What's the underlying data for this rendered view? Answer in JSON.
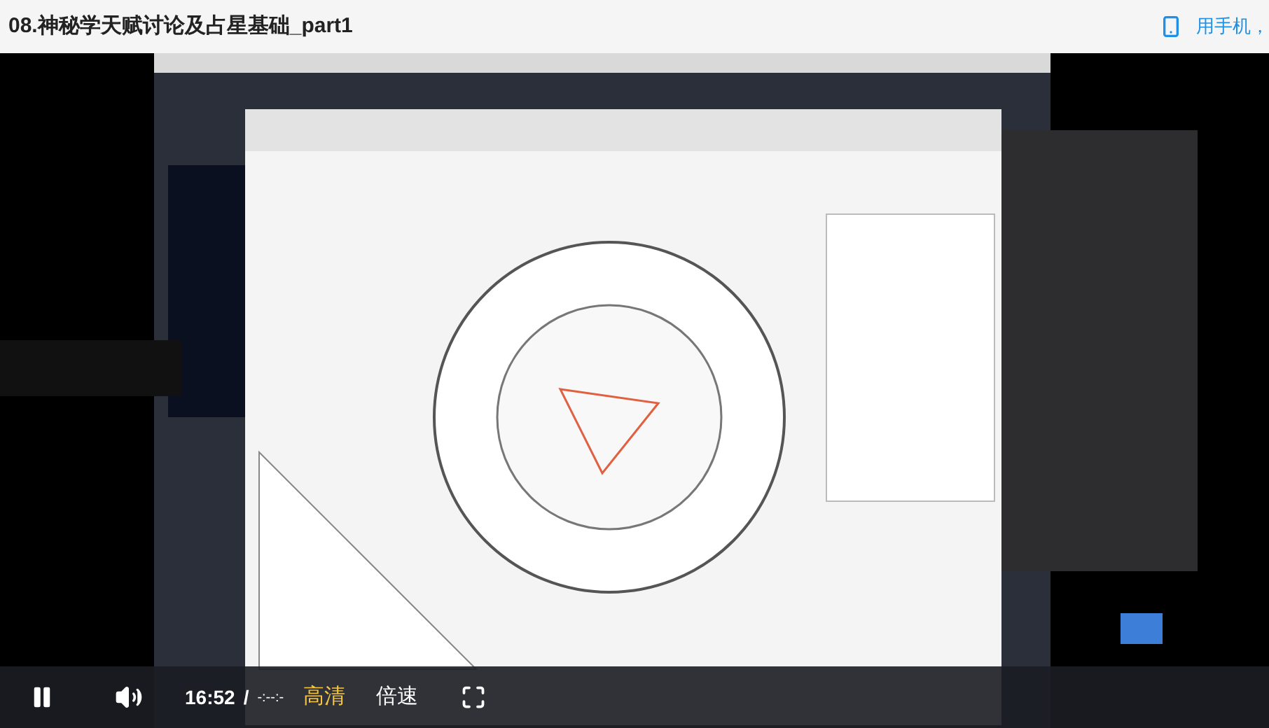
{
  "header": {
    "title": "08.神秘学天赋讨论及占星基础_part1",
    "mobile_link": "用手机，"
  },
  "controls": {
    "playing": true,
    "current_time": "16:52",
    "separator": "/",
    "duration": "-:--:-",
    "quality": "高清",
    "speed": "倍速"
  }
}
